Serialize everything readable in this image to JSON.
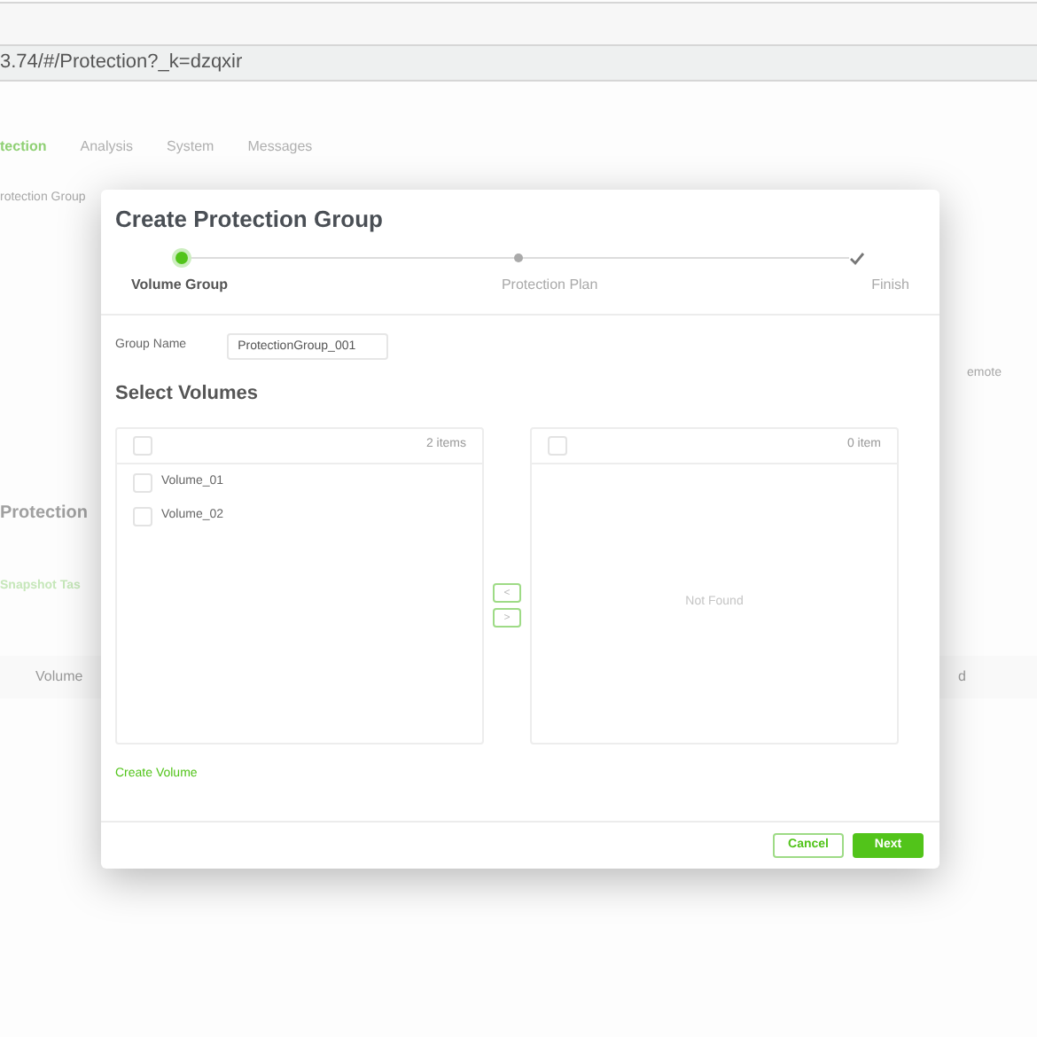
{
  "browser": {
    "address": "3.74/#/Protection?_k=dzqxir"
  },
  "nav": [
    {
      "label": "tection",
      "selected": true
    },
    {
      "label": "Analysis",
      "selected": false
    },
    {
      "label": "System",
      "selected": false
    },
    {
      "label": "Messages",
      "selected": false
    }
  ],
  "background": {
    "breadcrumb": "rotection Group",
    "card_text": "emote",
    "heading": "Protection",
    "tab": "Snapshot Tas",
    "column_left": "Volume",
    "column_right": "d"
  },
  "dialog": {
    "title": "Create Protection Group",
    "steps": [
      {
        "label": "Volume Group",
        "kind": "current"
      },
      {
        "label": "Protection Plan",
        "kind": "pending"
      },
      {
        "label": "Finish",
        "kind": "final"
      }
    ],
    "group_name": {
      "label": "Group Name",
      "value": "ProtectionGroup_001"
    },
    "section_title": "Select Volumes",
    "source_list": {
      "all_checked": false,
      "count": "2 items",
      "items": [
        {
          "label": "Volume_01",
          "checked": false
        },
        {
          "label": "Volume_02",
          "checked": false
        }
      ]
    },
    "target_list": {
      "all_checked": false,
      "count": "0 item",
      "empty_text": "Not Found"
    },
    "move_buttons": [
      "<",
      ">"
    ],
    "link": "Create Volume",
    "buttons": [
      {
        "label": "Cancel",
        "kind": "secondary"
      },
      {
        "label": "Next",
        "kind": "primary"
      }
    ]
  }
}
